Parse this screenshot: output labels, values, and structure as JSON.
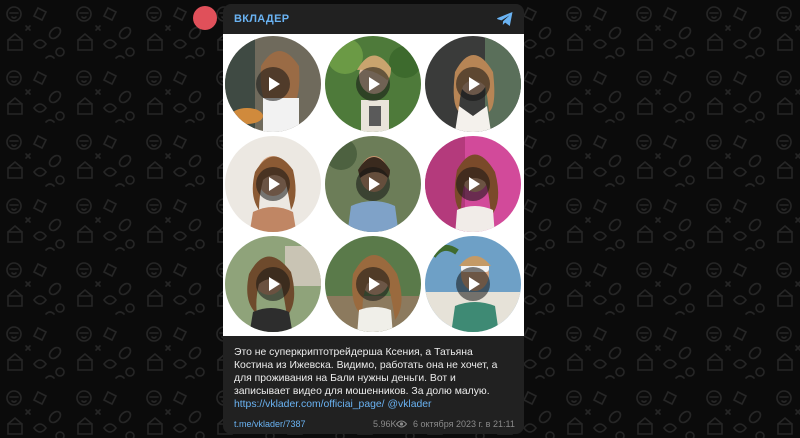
{
  "channel": {
    "name": "ВКЛАДЕР",
    "avatar_color": "#e0505a",
    "accent_color": "#6ab3f3"
  },
  "videos": [
    {
      "label": "video-1",
      "icon": "play-icon"
    },
    {
      "label": "video-2",
      "icon": "play-icon"
    },
    {
      "label": "video-3",
      "icon": "play-icon"
    },
    {
      "label": "video-4",
      "icon": "play-icon"
    },
    {
      "label": "video-5",
      "icon": "play-icon"
    },
    {
      "label": "video-6",
      "icon": "play-icon"
    },
    {
      "label": "video-7",
      "icon": "play-icon"
    },
    {
      "label": "video-8",
      "icon": "play-icon"
    },
    {
      "label": "video-9",
      "icon": "play-icon"
    }
  ],
  "post": {
    "text_lines": [
      "Это не суперкриптотрейдерша Ксения, а Татьяна",
      "Костина из Ижевска. Видимо, работать она не хочет, а",
      "для проживания на Бали нужны деньги. Вот и",
      "записывает видео для мошенников. За долю малую."
    ],
    "link_text": "https://vklader.com/officiai_page/",
    "mention": "@vklader",
    "permalink": "t.me/vklader/7387",
    "views": "5.96K",
    "date": "6 октября 2023 г. в 21:11"
  }
}
